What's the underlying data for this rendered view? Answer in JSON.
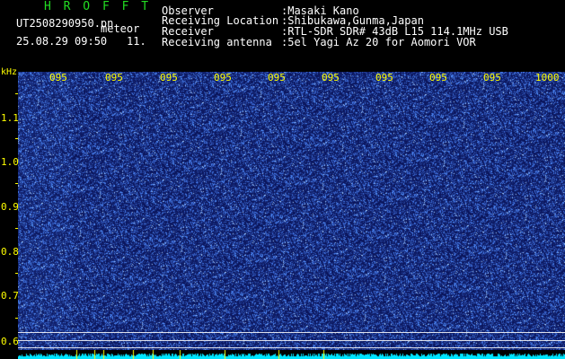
{
  "header": {
    "app_title": "H R O F F T",
    "file_name": "UT2508290950.pn",
    "mode_label": "meteor",
    "date_time": "25.08.29 09:50",
    "fft_num": "11."
  },
  "info": [
    {
      "label": "Observer",
      "value": ":Masaki Kano"
    },
    {
      "label": "Receiving Location",
      "value": ":Shibukawa,Gunma,Japan"
    },
    {
      "label": "Receiver",
      "value": ":RTL-SDR SDR# 43dB L15 114.1MHz USB"
    },
    {
      "label": "Receiving antenna",
      "value": ":5el Yagi Az 20 for Aomori VOR"
    }
  ],
  "plot": {
    "y_unit": "kHz",
    "y_ticks": [
      "1.1",
      "1.0",
      "0.9",
      "0.8",
      "0.7",
      "0.6"
    ],
    "x_ticks": [
      "095",
      "095",
      "095",
      "095",
      "095",
      "095",
      "095",
      "095",
      "095",
      "1000"
    ],
    "colors": {
      "background": "#0a1a6e",
      "noise": "#3a5aff",
      "tick_text": "#ffff00",
      "signal_bar": "#00e5ff",
      "title": "#22dd22"
    }
  }
}
